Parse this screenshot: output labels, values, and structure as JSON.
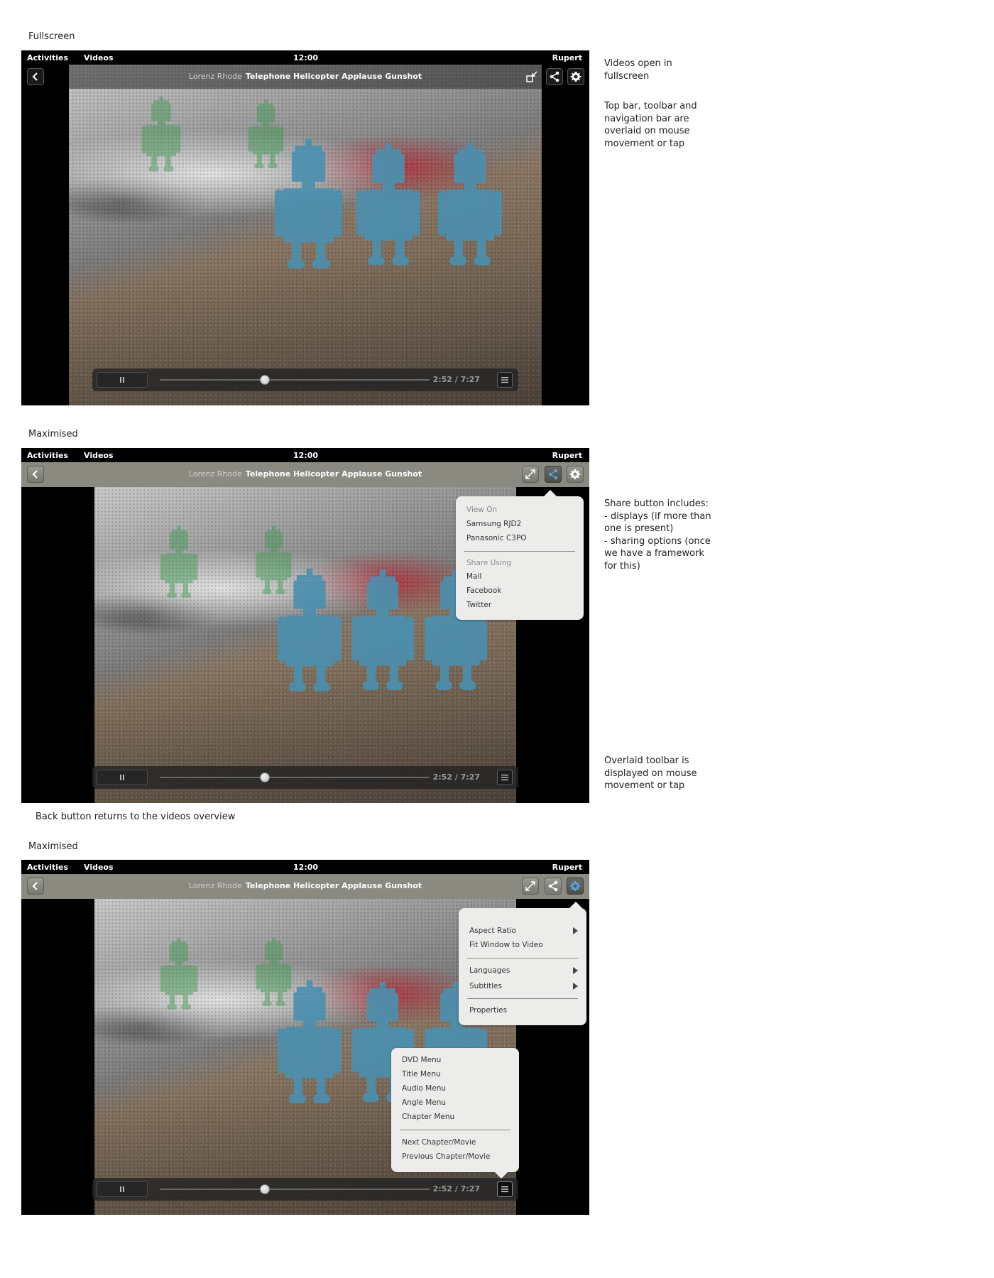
{
  "topbar": {
    "activities": "Activities",
    "app": "Videos",
    "clock": "12:00",
    "user": "Rupert"
  },
  "header": {
    "artist": "Lorenz Rhode",
    "title": "Telephone Helicopter Applause Gunshot"
  },
  "player": {
    "time": "2:52 / 7:27",
    "progress_fraction": 0.39
  },
  "icons": {
    "back": "chevron-left-icon",
    "fullscreen": "fullscreen-icon",
    "unfullscreen": "restore-icon",
    "share": "share-icon",
    "settings": "gear-icon",
    "pause": "pause-icon",
    "menu": "hamburger-menu-icon"
  },
  "colors": {
    "accent": "#5aa0d8",
    "headerbar": "#8a8a80",
    "popover": "#ececea",
    "robot": "#4a90b0",
    "robot_green": "#3a9a50"
  },
  "sections": [
    {
      "label": "Fullscreen",
      "notes": [
        "Videos open in fullscreen",
        "Top bar, toolbar and navigation bar are overlaid on mouse movement or tap"
      ]
    },
    {
      "label": "Maximised",
      "notes": [
        "Share button includes:\n - displays (if more than one is present)\n - sharing options (once we have a framework for this)",
        "Overlaid toolbar is displayed on mouse movement or tap"
      ],
      "below": "Back button returns to the videos overview"
    },
    {
      "label": "Maximised"
    }
  ],
  "share_menu": {
    "view_on_heading": "View On",
    "devices": [
      "Samsung RJD2",
      "Panasonic C3PO"
    ],
    "share_using_heading": "Share Using",
    "services": [
      "Mail",
      "Facebook",
      "Twitter"
    ]
  },
  "settings_menu": {
    "group1": [
      "Aspect Ratio",
      "Fit Window to Video"
    ],
    "group2": [
      "Languages",
      "Subtitles"
    ],
    "group3": [
      "Properties"
    ]
  },
  "dvd_menu": {
    "group1": [
      "DVD Menu",
      "Title Menu",
      "Audio Menu",
      "Angle Menu",
      "Chapter Menu"
    ],
    "group2": [
      "Next Chapter/Movie",
      "Previous Chapter/Movie"
    ]
  }
}
